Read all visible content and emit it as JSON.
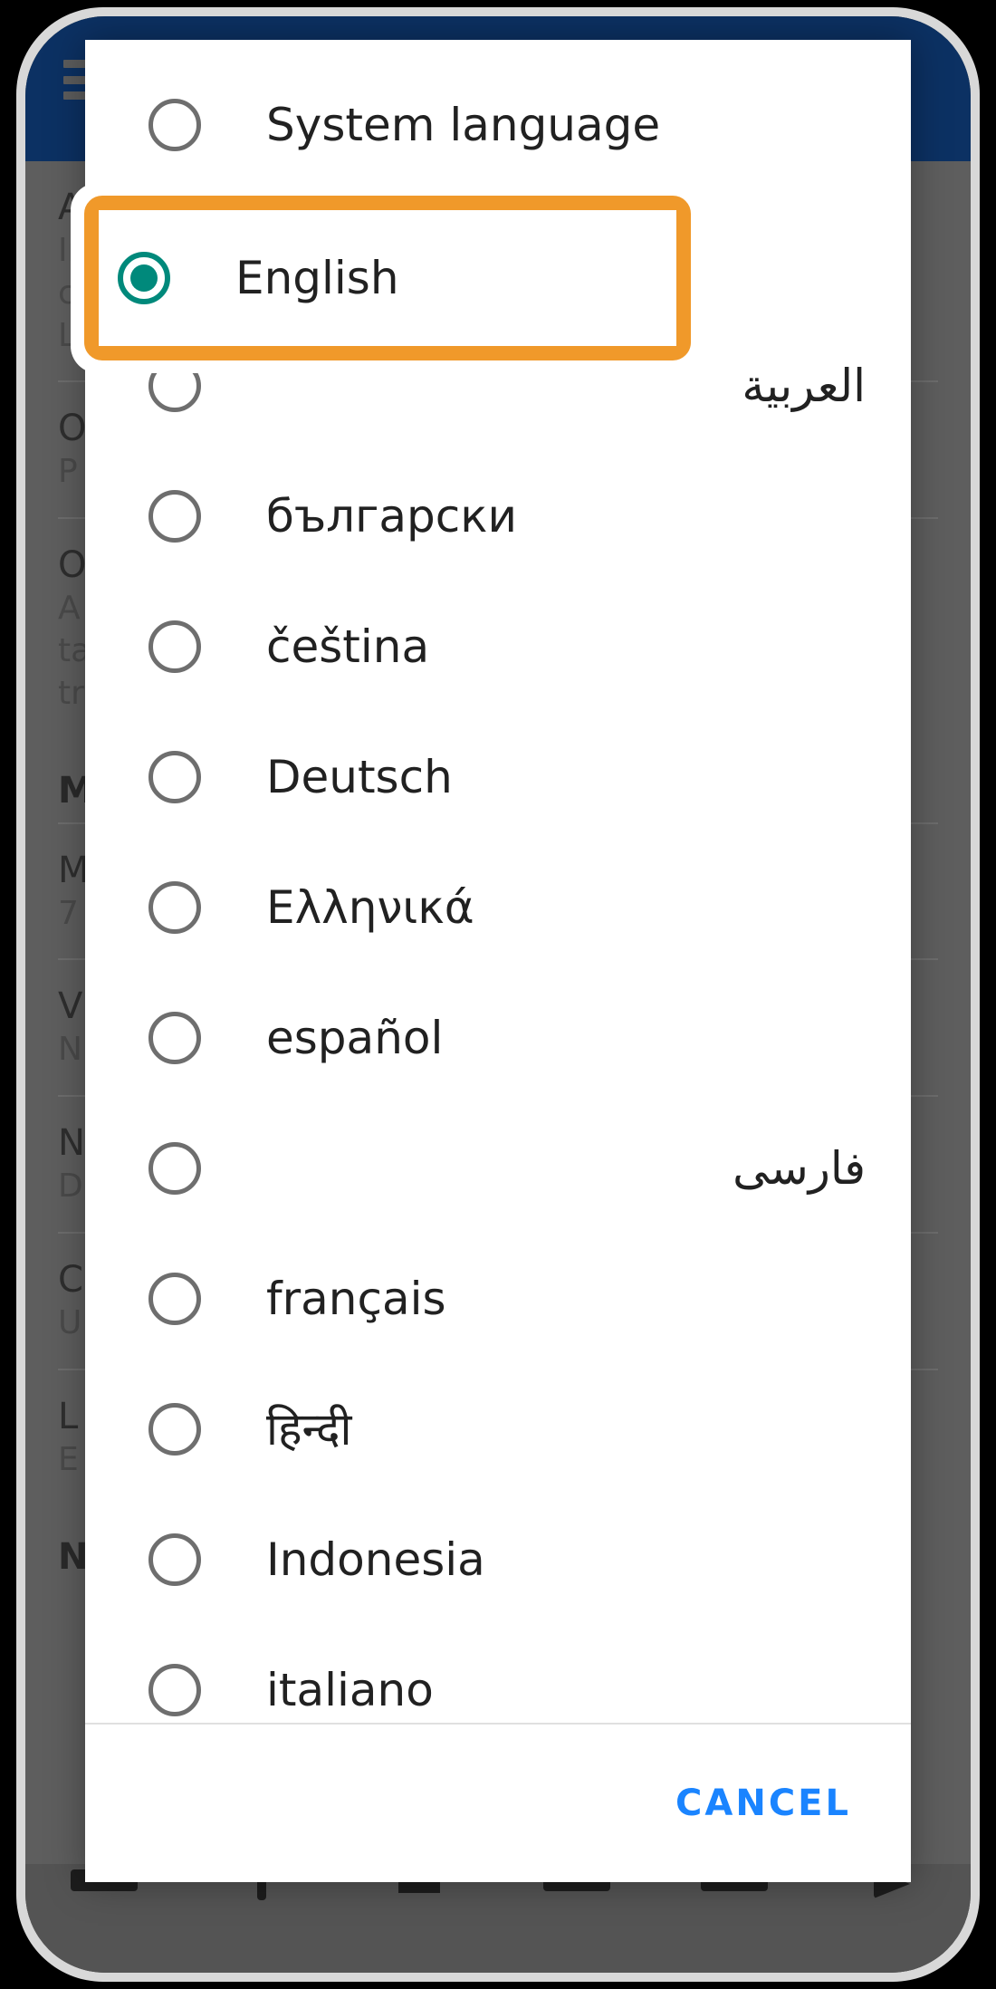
{
  "app": {
    "appbar_background": "#0c3163",
    "scrim_color": "#5e5e5e",
    "menu_icon": "hamburger-menu-icon"
  },
  "background_page": {
    "rows": [
      {
        "title": "A",
        "sub1": "In",
        "sub2": "co",
        "sub3": "Lo",
        "switch": "none"
      },
      {
        "title": "O",
        "sub1": "P",
        "sub2": "",
        "sub3": "",
        "switch": "on"
      },
      {
        "title": "O",
        "sub1": "A",
        "sub2": "ta",
        "sub3": "tr",
        "switch": "on"
      }
    ],
    "section_title": "M",
    "rows2": [
      {
        "title": "M",
        "sub1": "7",
        "switch": "none"
      },
      {
        "title": "V",
        "sub1": "N",
        "switch": "none"
      },
      {
        "title": "N",
        "sub1": "D",
        "switch": "none"
      },
      {
        "title": "C",
        "sub1": "U",
        "switch": "none"
      },
      {
        "title": "L",
        "sub1": "E",
        "switch": "none"
      }
    ],
    "section_title2": "N",
    "bottom_nav_icons": [
      "nav-icon-1",
      "nav-icon-2",
      "nav-icon-3",
      "nav-icon-4",
      "nav-icon-5"
    ]
  },
  "dialog": {
    "languages": [
      {
        "label": "System language",
        "selected": false,
        "rtl": false
      },
      {
        "label": "English",
        "selected": true,
        "rtl": false
      },
      {
        "label": "العربية",
        "selected": false,
        "rtl": true
      },
      {
        "label": "български",
        "selected": false,
        "rtl": false
      },
      {
        "label": "čeština",
        "selected": false,
        "rtl": false
      },
      {
        "label": "Deutsch",
        "selected": false,
        "rtl": false
      },
      {
        "label": "Ελληνικά",
        "selected": false,
        "rtl": false
      },
      {
        "label": "español",
        "selected": false,
        "rtl": false
      },
      {
        "label": "فارسی",
        "selected": false,
        "rtl": true
      },
      {
        "label": "français",
        "selected": false,
        "rtl": false
      },
      {
        "label": "हिन्दी",
        "selected": false,
        "rtl": false
      },
      {
        "label": "Indonesia",
        "selected": false,
        "rtl": false
      },
      {
        "label": "italiano",
        "selected": false,
        "rtl": false
      }
    ],
    "cancel_label": "CANCEL",
    "cancel_color": "#1a84ff",
    "selected_radio_color": "#00897b",
    "unselected_radio_color": "#6e6e6e"
  },
  "annotation": {
    "highlight_color": "#f0992a",
    "highlight_target": "English"
  }
}
